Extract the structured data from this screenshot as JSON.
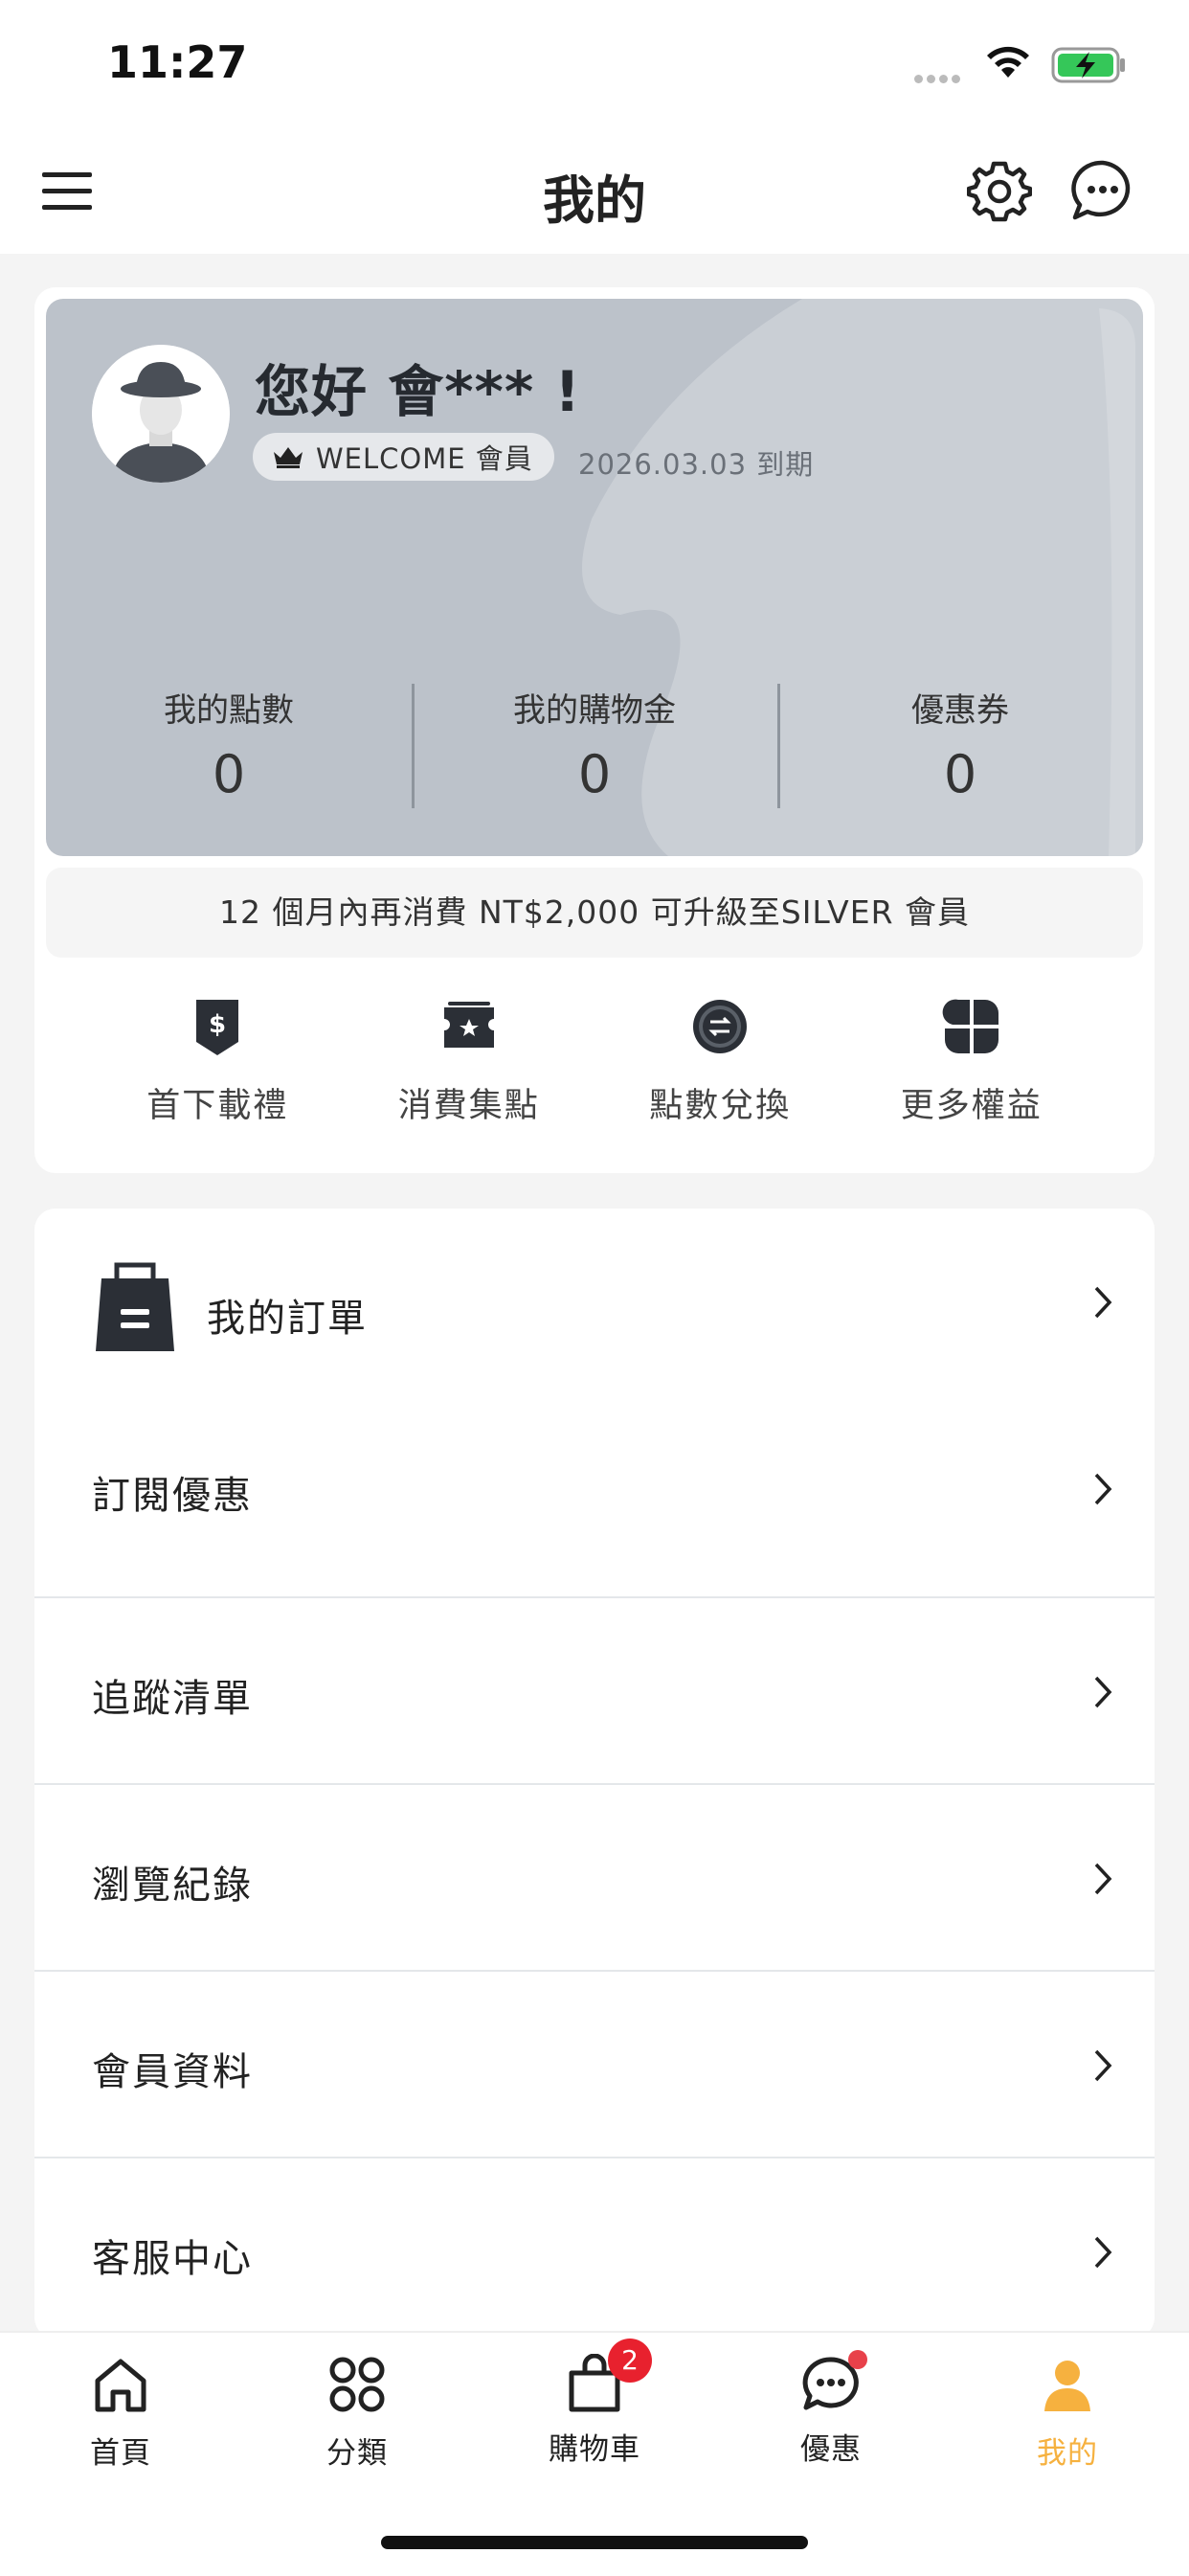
{
  "status_bar": {
    "time": "11:27"
  },
  "header": {
    "title": "我的"
  },
  "member": {
    "greeting": "您好 會*** !",
    "tier_label": "WELCOME 會員",
    "expiry": "2026.03.03 到期",
    "stats": [
      {
        "label": "我的點數",
        "value": "0"
      },
      {
        "label": "我的購物金",
        "value": "0"
      },
      {
        "label": "優惠券",
        "value": "0"
      }
    ],
    "upgrade_notice": "12 個月內再消費 NT$2,000 可升級至SILVER 會員",
    "benefits": [
      {
        "label": "首下載禮",
        "icon": "dollar-tag-icon"
      },
      {
        "label": "消費集點",
        "icon": "star-ticket-icon"
      },
      {
        "label": "點數兌換",
        "icon": "exchange-icon"
      },
      {
        "label": "更多權益",
        "icon": "grid-more-icon"
      }
    ]
  },
  "menu": {
    "orders": "我的訂單",
    "items": [
      "訂閱優惠",
      "追蹤清單",
      "瀏覽紀錄",
      "會員資料",
      "客服中心"
    ]
  },
  "tabbar": {
    "tabs": [
      {
        "label": "首頁",
        "icon": "home-icon"
      },
      {
        "label": "分類",
        "icon": "category-icon"
      },
      {
        "label": "購物車",
        "icon": "cart-icon"
      },
      {
        "label": "優惠",
        "icon": "promo-chat-icon"
      },
      {
        "label": "我的",
        "icon": "profile-icon"
      }
    ],
    "cart_badge": "2",
    "active_color": "#f6b13f"
  }
}
